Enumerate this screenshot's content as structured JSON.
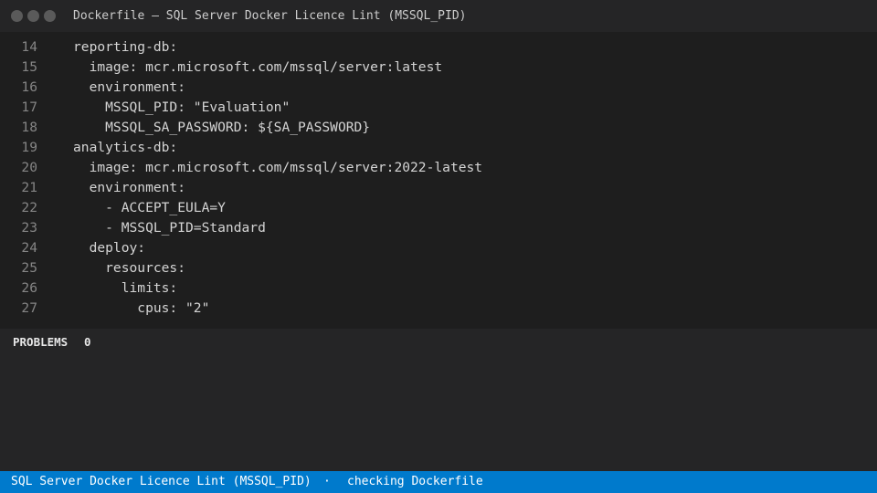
{
  "window": {
    "title": "Dockerfile — SQL Server Docker Licence Lint (MSSQL_PID)"
  },
  "editor": {
    "lines": [
      {
        "no": "14",
        "text": "reporting-db:"
      },
      {
        "no": "15",
        "text": "  image: mcr.microsoft.com/mssql/server:latest"
      },
      {
        "no": "16",
        "text": "  environment:"
      },
      {
        "no": "17",
        "text": "    MSSQL_PID: \"Evaluation\""
      },
      {
        "no": "18",
        "text": "    MSSQL_SA_PASSWORD: ${SA_PASSWORD}"
      },
      {
        "no": "19",
        "text": "analytics-db:"
      },
      {
        "no": "20",
        "text": "  image: mcr.microsoft.com/mssql/server:2022-latest"
      },
      {
        "no": "21",
        "text": "  environment:"
      },
      {
        "no": "22",
        "text": "    - ACCEPT_EULA=Y"
      },
      {
        "no": "23",
        "text": "    - MSSQL_PID=Standard"
      },
      {
        "no": "24",
        "text": "  deploy:"
      },
      {
        "no": "25",
        "text": "    resources:"
      },
      {
        "no": "26",
        "text": "      limits:"
      },
      {
        "no": "27",
        "text": "        cpus: \"2\""
      }
    ]
  },
  "panel": {
    "problems_label": "PROBLEMS",
    "problems_count": "0"
  },
  "statusbar": {
    "extension": "SQL Server Docker Licence Lint (MSSQL_PID)",
    "separator": "·",
    "status": "checking Dockerfile"
  }
}
